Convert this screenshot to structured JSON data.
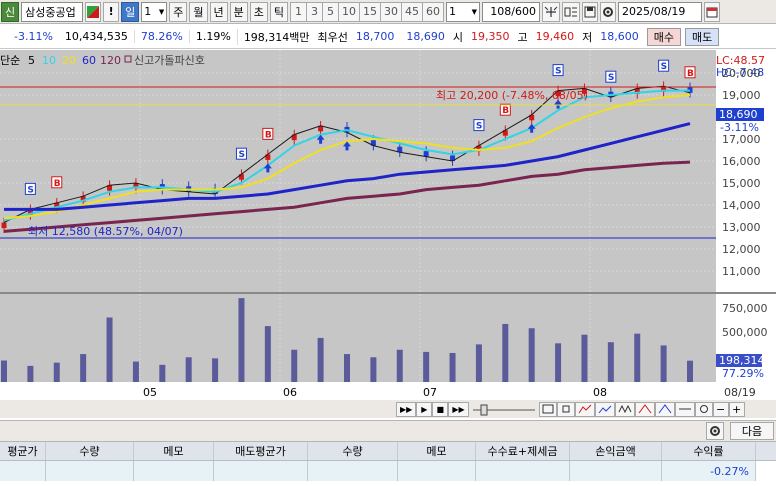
{
  "toolbar": {
    "badge": "신",
    "stock_name": "삼성중공업",
    "day_label": "일",
    "day_value": "1",
    "period_buttons": [
      "주",
      "월",
      "년",
      "분",
      "초",
      "틱"
    ],
    "minute_buttons": [
      "1",
      "3",
      "5",
      "10",
      "15",
      "30",
      "45",
      "60"
    ],
    "interval_value": "1",
    "count_value": "108",
    "count_total": "/600",
    "date_value": "2025/08/19"
  },
  "quote": {
    "change_pct": "-3.11%",
    "volume": "10,434,535",
    "volume_ratio": "78.26%",
    "turnover": "1.19%",
    "amount": "198,314백만",
    "best_bid_label": "최우선",
    "ask_price": "18,700",
    "bid_price": "18,690",
    "open_label": "시",
    "open": "19,350",
    "high_label": "고",
    "high": "19,460",
    "low_label": "저",
    "low": "18,600",
    "buy_button": "매수",
    "sell_button": "매도"
  },
  "chart": {
    "legend_ma_label": "단순",
    "legend_ma": [
      "5",
      "10",
      "20",
      "60",
      "120"
    ],
    "legend_signal": "신고가돌파신호",
    "lc_readout": "LC:48.57",
    "hc_readout": "HC:-7.48",
    "high_annotation": "최고 20,200 (-7.48%, 08/05)",
    "low_annotation": "최저 12,580 (48.57%, 04/07)",
    "price_ticks": [
      "20,000",
      "19,000",
      "17,000",
      "16,000",
      "15,000",
      "14,000",
      "13,000",
      "12,000",
      "11,000"
    ],
    "current_price": "18,690",
    "current_change": "-3.11%",
    "volume_ticks": [
      "750,000",
      "500,000"
    ],
    "volume_current": "198,314",
    "volume_pct": "77.29%",
    "month_labels": [
      "05",
      "06",
      "07",
      "08"
    ],
    "last_date": "08/19",
    "colors": {
      "up": "#d21919",
      "down": "#1f3fcf",
      "ma5": "#1a1a1a",
      "ma10": "#2fd4e6",
      "ma20": "#f0e020",
      "ma60": "#1f24c8",
      "ma120": "#7a2450",
      "volume": "#5b5b9b"
    }
  },
  "chart_data": {
    "type": "line",
    "title": "",
    "ylabel": "",
    "high": 20200,
    "low": 12580,
    "current": 18690,
    "ylim": [
      10500,
      20500
    ],
    "series": [
      {
        "name": "5",
        "values": [
          13200,
          13800,
          14100,
          14400,
          14900,
          15000,
          14700,
          14600,
          14500,
          15400,
          16300,
          17200,
          17600,
          17300,
          16700,
          16400,
          16200,
          16000,
          16700,
          17400,
          18100,
          19200,
          19300,
          18900,
          19300,
          19400,
          19100
        ]
      },
      {
        "name": "10",
        "values": [
          13300,
          13600,
          13900,
          14200,
          14600,
          14800,
          14800,
          14700,
          14600,
          15000,
          15800,
          16700,
          17200,
          17400,
          17100,
          16800,
          16500,
          16300,
          16500,
          17000,
          17500,
          18300,
          18900,
          19000,
          19100,
          19200,
          19200
        ]
      },
      {
        "name": "20",
        "values": [
          13400,
          13500,
          13700,
          14000,
          14300,
          14600,
          14700,
          14700,
          14700,
          14800,
          15200,
          15900,
          16500,
          16900,
          17000,
          16900,
          16800,
          16600,
          16500,
          16600,
          16900,
          17500,
          18000,
          18400,
          18700,
          18900,
          19000
        ]
      },
      {
        "name": "60",
        "values": [
          13800,
          13800,
          13800,
          13900,
          14000,
          14100,
          14200,
          14300,
          14300,
          14400,
          14500,
          14700,
          14900,
          15100,
          15200,
          15400,
          15500,
          15600,
          15700,
          15800,
          16000,
          16200,
          16500,
          16800,
          17100,
          17400,
          17700
        ]
      },
      {
        "name": "120",
        "values": [
          12800,
          12900,
          13000,
          13100,
          13200,
          13300,
          13400,
          13500,
          13600,
          13700,
          13800,
          13900,
          14100,
          14300,
          14400,
          14500,
          14700,
          14800,
          14900,
          15100,
          15300,
          15400,
          15600,
          15700,
          15800,
          15900,
          15950
        ]
      }
    ],
    "volume": [
      200000,
      150000,
      180000,
      260000,
      600000,
      190000,
      160000,
      230000,
      220000,
      780000,
      520000,
      300000,
      410000,
      260000,
      230000,
      300000,
      280000,
      270000,
      350000,
      540000,
      500000,
      360000,
      440000,
      370000,
      450000,
      340000,
      198314
    ]
  },
  "controls": {
    "buttons": [
      "▶▶",
      "▶",
      "■",
      "▶▶"
    ]
  },
  "panel": {
    "next_button": "다음"
  },
  "table": {
    "headers": [
      "평균가",
      "수량",
      "메모",
      "매도평균가",
      "수량",
      "메모",
      "수수료+제세금",
      "손익금액",
      "수익률"
    ],
    "row": [
      "",
      "",
      "",
      "",
      "",
      "",
      "",
      "",
      "-0.27%"
    ]
  }
}
